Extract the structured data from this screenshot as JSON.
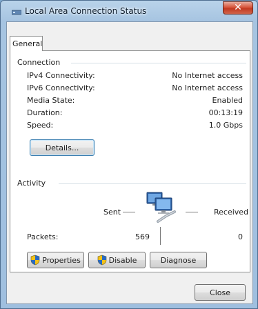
{
  "window": {
    "title": "Local Area Connection Status",
    "close_glyph": "✕"
  },
  "tabs": [
    {
      "label": "General"
    }
  ],
  "connection": {
    "group_label": "Connection",
    "rows": [
      {
        "label": "IPv4 Connectivity:",
        "value": "No Internet access"
      },
      {
        "label": "IPv6 Connectivity:",
        "value": "No Internet access"
      },
      {
        "label": "Media State:",
        "value": "Enabled"
      },
      {
        "label": "Duration:",
        "value": "00:13:19"
      },
      {
        "label": "Speed:",
        "value": "1.0 Gbps"
      }
    ],
    "details_button": "Details..."
  },
  "activity": {
    "group_label": "Activity",
    "sent_label": "Sent",
    "received_label": "Received",
    "packets_label": "Packets:",
    "packets_sent": "569",
    "packets_received": "0",
    "icon": "network-computers-icon"
  },
  "buttons": {
    "properties": "Properties",
    "disable": "Disable",
    "diagnose": "Diagnose",
    "close": "Close"
  },
  "colors": {
    "title_bg": "#a6c4e1",
    "close_red": "#c23a21",
    "shield_blue": "#2a6ac0",
    "shield_yellow": "#f3c21a"
  }
}
